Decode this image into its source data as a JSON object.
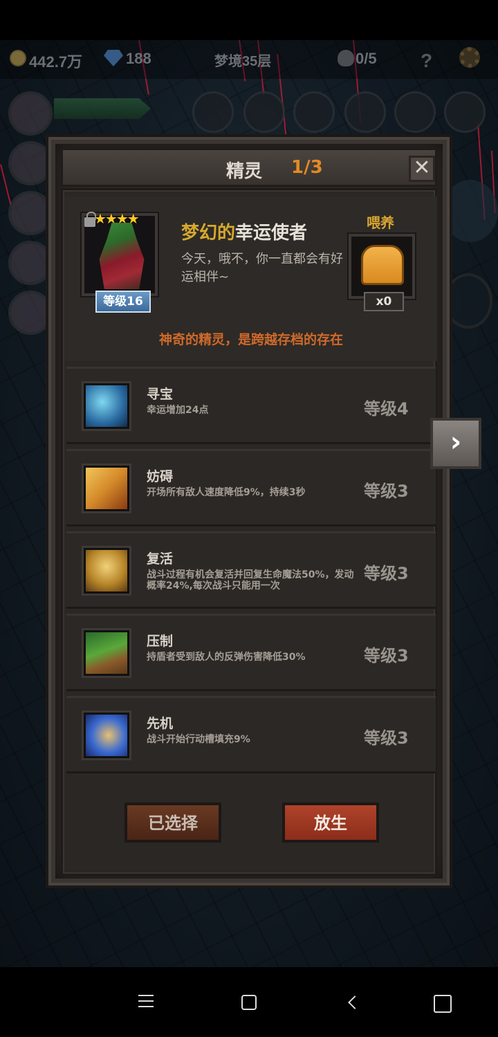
{
  "topbar": {
    "coins": "442.7万",
    "gems": "188",
    "floor": "梦境35层",
    "kills": "0/5",
    "help": "?"
  },
  "panel": {
    "title": "精灵",
    "page": "1/3",
    "close_symbol": "✕"
  },
  "spirit": {
    "stars": "★★★★",
    "name_part1": "梦幻的",
    "name_part2": "幸运使者",
    "description": "今天，哦不，你一直都会有好运相伴~",
    "level": "等级16",
    "feed_label": "喂养",
    "feed_count": "x0",
    "tagline": "神奇的精灵，是跨越存档的存在"
  },
  "skills": [
    {
      "name": "寻宝",
      "desc": "幸运增加24点",
      "level": "等级4",
      "icon": "silhouette-stars-icon"
    },
    {
      "name": "妨碍",
      "desc": "开场所有敌人速度降低9%，持续3秒",
      "level": "等级3",
      "icon": "chained-boot-icon"
    },
    {
      "name": "复活",
      "desc": "战斗过程有机会复活并回复生命魔法50%，发动概率24%,每次战斗只能用一次",
      "level": "等级3",
      "icon": "dancing-figure-icon"
    },
    {
      "name": "压制",
      "desc": "持盾者受到敌人的反弹伤害降低30%",
      "level": "等级3",
      "icon": "beast-claw-icon"
    },
    {
      "name": "先机",
      "desc": "战斗开始行动槽填充9%",
      "level": "等级3",
      "icon": "leopard-icon"
    }
  ],
  "buttons": {
    "selected": "已选择",
    "release": "放生"
  },
  "next_symbol": "›",
  "colors": {
    "title_accent": "#e38a25",
    "name_gold": "#d6a92e",
    "tagline": "#d06a2a",
    "release_button": "#b0432a"
  }
}
